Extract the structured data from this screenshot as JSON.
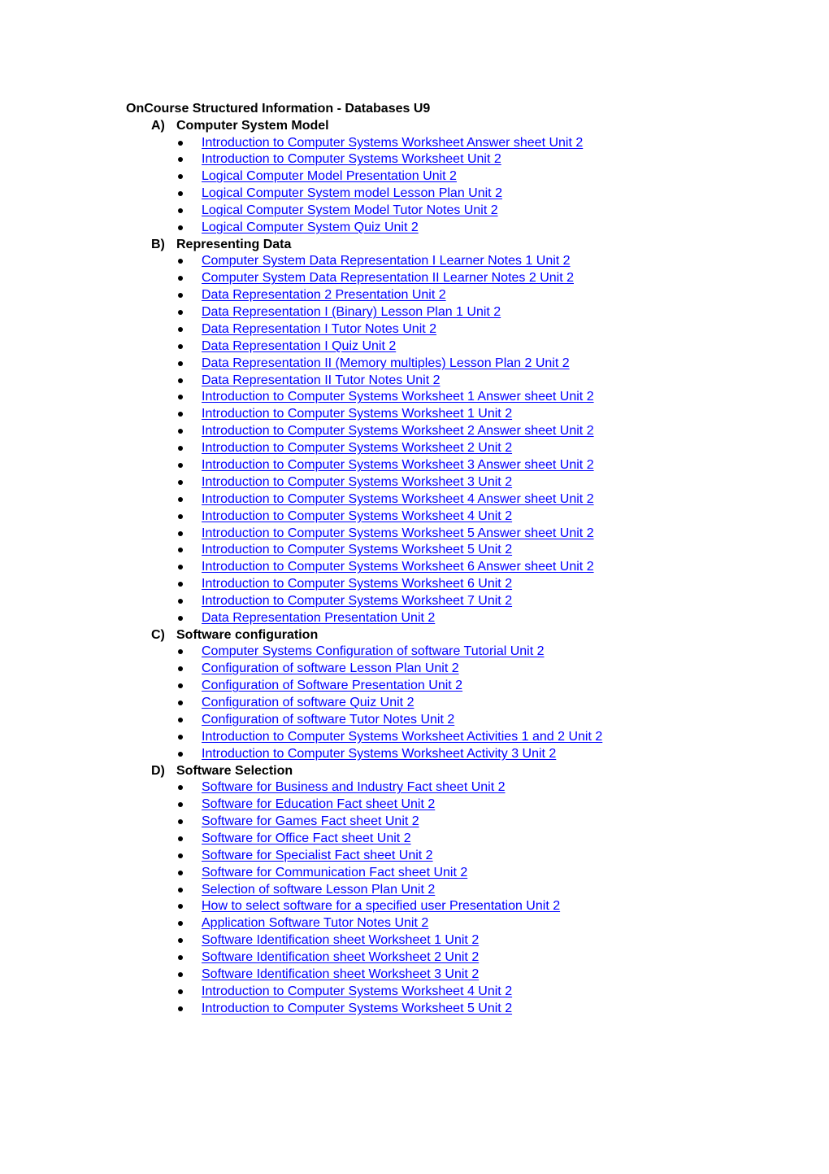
{
  "document": {
    "title": "OnCourse Structured Information - Databases U9",
    "colors": {
      "link": "#0000ff",
      "text": "#000000"
    },
    "sections": [
      {
        "letter": "A)",
        "heading": "Computer System Model",
        "items": [
          "Introduction to Computer Systems Worksheet Answer sheet Unit 2",
          "Introduction to Computer Systems Worksheet Unit 2",
          "Logical Computer Model Presentation Unit 2",
          "Logical Computer System model Lesson Plan Unit 2",
          "Logical Computer System Model Tutor Notes Unit 2",
          "Logical Computer System Quiz Unit 2"
        ]
      },
      {
        "letter": "B)",
        "heading": "Representing Data",
        "items": [
          "Computer System Data Representation I Learner Notes 1 Unit 2",
          "Computer System Data Representation II Learner Notes 2 Unit 2",
          "Data Representation 2 Presentation Unit 2",
          "Data Representation I (Binary) Lesson Plan 1 Unit 2",
          "Data Representation I Tutor Notes Unit 2",
          "Data Representation I Quiz Unit 2",
          "Data Representation II (Memory multiples) Lesson Plan 2 Unit 2",
          "Data Representation II Tutor Notes Unit 2",
          "Introduction to Computer Systems Worksheet 1 Answer sheet Unit 2",
          "Introduction to Computer Systems Worksheet 1 Unit 2",
          "Introduction to Computer Systems Worksheet 2 Answer sheet Unit 2",
          "Introduction to Computer Systems Worksheet 2 Unit 2",
          "Introduction to Computer Systems Worksheet 3 Answer sheet Unit 2",
          "Introduction to Computer Systems Worksheet 3 Unit 2",
          "Introduction to Computer Systems Worksheet 4 Answer sheet Unit 2",
          "Introduction to Computer Systems Worksheet 4 Unit 2",
          "Introduction to Computer Systems Worksheet 5 Answer sheet Unit 2",
          "Introduction to Computer Systems Worksheet 5 Unit 2",
          "Introduction to Computer Systems Worksheet 6 Answer sheet Unit 2",
          "Introduction to Computer Systems Worksheet 6 Unit 2",
          "Introduction to Computer Systems Worksheet 7 Unit 2",
          "Data Representation Presentation Unit 2"
        ]
      },
      {
        "letter": "C)",
        "heading": "Software configuration",
        "items": [
          "Computer Systems Configuration of software Tutorial Unit 2",
          "Configuration of software Lesson Plan Unit 2",
          "Configuration of Software Presentation Unit 2",
          "Configuration of software Quiz Unit 2",
          "Configuration of software Tutor Notes Unit 2",
          "Introduction to Computer Systems Worksheet Activities 1 and 2 Unit 2",
          "Introduction to Computer Systems Worksheet Activity 3 Unit 2"
        ]
      },
      {
        "letter": "D)",
        "heading": "Software Selection",
        "items": [
          "Software for Business and Industry Fact sheet Unit 2",
          "Software for Education Fact sheet Unit 2",
          "Software for Games Fact sheet Unit 2",
          "Software for Office Fact sheet Unit 2",
          "Software for Specialist Fact sheet Unit 2",
          "Software for Communication Fact sheet Unit 2",
          "Selection of software Lesson Plan Unit 2",
          "How to select software for a specified user Presentation Unit 2",
          "Application Software Tutor Notes Unit 2",
          "Software Identification sheet Worksheet 1 Unit 2",
          "Software Identification sheet Worksheet 2 Unit 2",
          "Software Identification sheet Worksheet 3 Unit 2",
          "Introduction to Computer Systems Worksheet 4 Unit 2",
          "Introduction to Computer Systems Worksheet 5 Unit 2"
        ]
      }
    ]
  }
}
